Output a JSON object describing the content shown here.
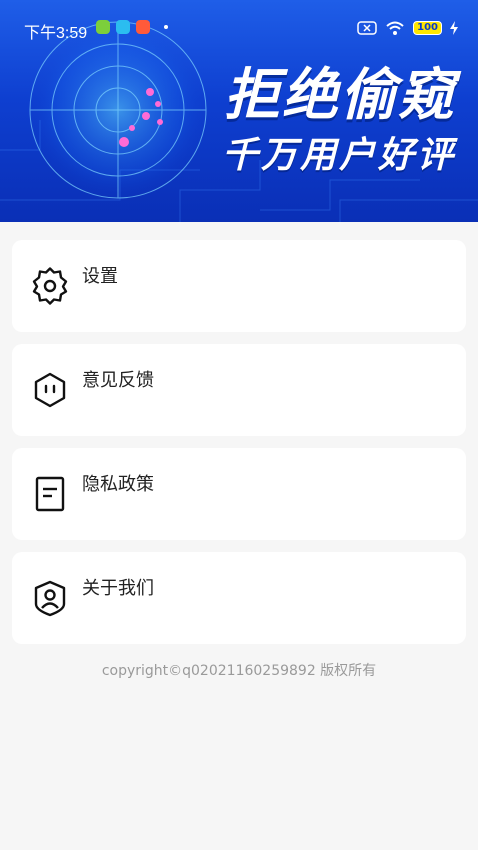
{
  "status_bar": {
    "time": "下午3:59",
    "battery": "100"
  },
  "banner": {
    "headline": "拒绝偷窥",
    "subheadline": "千万用户好评"
  },
  "menu": {
    "items": [
      {
        "label": "设置",
        "icon": "gear-icon"
      },
      {
        "label": "意见反馈",
        "icon": "feedback-hexagon-icon"
      },
      {
        "label": "隐私政策",
        "icon": "document-icon"
      },
      {
        "label": "关于我们",
        "icon": "user-shield-icon"
      }
    ]
  },
  "footer": {
    "copyright": "copyright©q02021160259892 版权所有"
  },
  "colors": {
    "banner_blue": "#1f5ee8",
    "page_bg": "#f6f6f6",
    "text": "#222222",
    "muted": "#9a9a9a"
  }
}
